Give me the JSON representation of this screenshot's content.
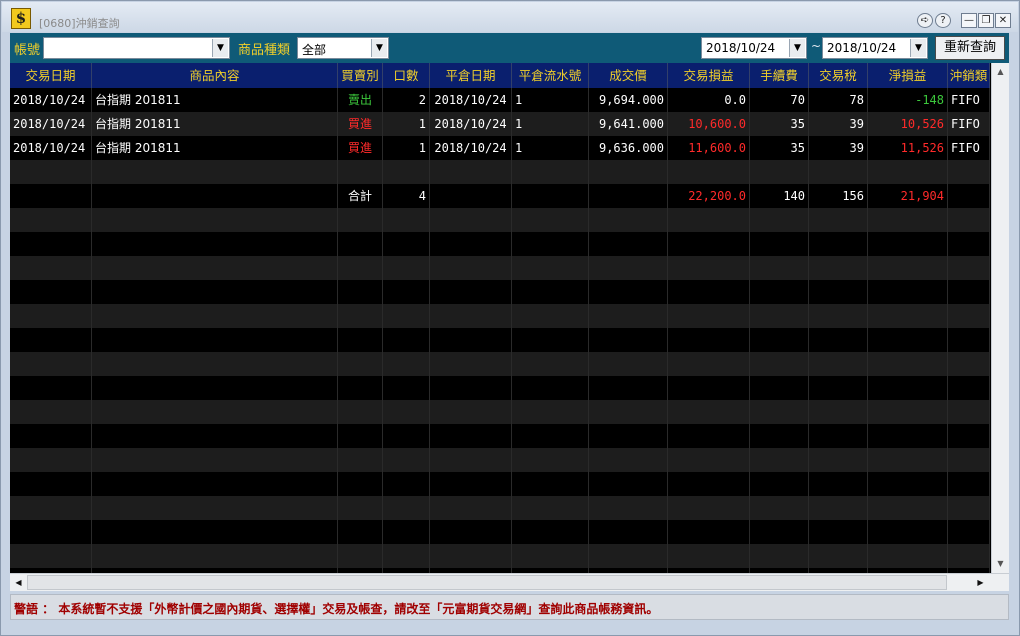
{
  "window": {
    "title": "[0680]沖銷查詢",
    "app_icon": "$",
    "controls": [
      "➪",
      "?",
      "—",
      "❐",
      "✕"
    ]
  },
  "toolbar": {
    "account_label": "帳號",
    "account_value": "",
    "product_type_label": "商品種類",
    "product_type_value": "全部",
    "date_from": "2018/10/24",
    "date_separator": "~",
    "date_to": "2018/10/24",
    "requery_button": "重新查詢"
  },
  "table": {
    "headers": [
      "交易日期",
      "商品內容",
      "買賣別",
      "口數",
      "平倉日期",
      "平倉流水號",
      "成交價",
      "交易損益",
      "手續費",
      "交易稅",
      "淨損益",
      "沖銷類"
    ],
    "rows": [
      [
        "2018/10/24",
        "台指期 201811",
        "賣出",
        "2",
        "2018/10/24",
        "1",
        "9,694.000",
        "0.0",
        "70",
        "78",
        "-148",
        "FIFO"
      ],
      [
        "2018/10/24",
        "台指期 201811",
        "買進",
        "1",
        "2018/10/24",
        "1",
        "9,641.000",
        "10,600.0",
        "35",
        "39",
        "10,526",
        "FIFO"
      ],
      [
        "2018/10/24",
        "台指期 201811",
        "買進",
        "1",
        "2018/10/24",
        "1",
        "9,636.000",
        "11,600.0",
        "35",
        "39",
        "11,526",
        "FIFO"
      ]
    ],
    "total_row": [
      "",
      "",
      "合計",
      "4",
      "",
      "",
      "",
      "22,200.0",
      "140",
      "156",
      "21,904",
      ""
    ]
  },
  "colors": {
    "header_bg": "#0a1f6e",
    "header_text": "#f0cf2a",
    "buy": "#ff2a2a",
    "sell": "#3cc83c",
    "profit": "#ff2a2a",
    "loss": "#3cc83c",
    "warning": "#a00000"
  },
  "warning": "警語 ： 本系統暫不支援「外幣計價之國內期貨、選擇權」交易及帳查，請改至「元富期貨交易網」查詢此商品帳務資訊。"
}
